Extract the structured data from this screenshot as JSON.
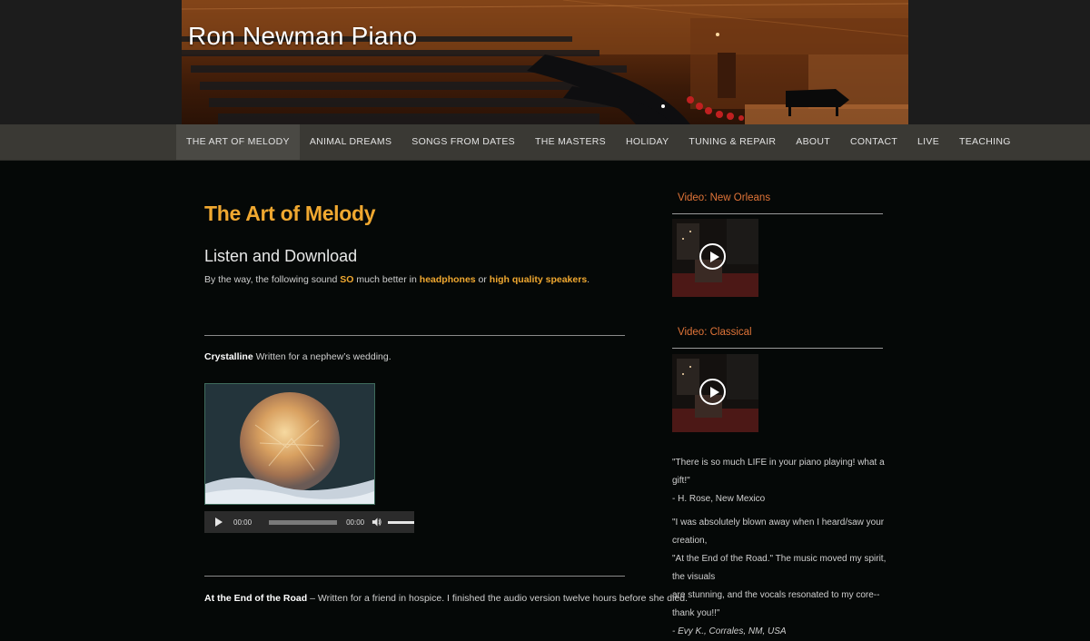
{
  "site": {
    "title": "Ron Newman Piano"
  },
  "nav": {
    "items": [
      {
        "label": "THE ART OF MELODY",
        "active": true
      },
      {
        "label": "ANIMAL DREAMS"
      },
      {
        "label": "SONGS FROM DATES"
      },
      {
        "label": "THE MASTERS"
      },
      {
        "label": "HOLIDAY"
      },
      {
        "label": "TUNING & REPAIR"
      },
      {
        "label": "ABOUT"
      },
      {
        "label": "CONTACT"
      },
      {
        "label": "LIVE"
      },
      {
        "label": "TEACHING"
      }
    ]
  },
  "main": {
    "title": "The Art of Melody",
    "subtitle": "Listen and Download",
    "intro": {
      "part1": "By the way, the following sound ",
      "so": "SO",
      "part2": " much better in ",
      "headphones": "headphones",
      "part3": " or ",
      "speakers": "high quality speakers",
      "part4": "."
    },
    "track1": {
      "name": "Crystalline",
      "desc": " Written for a nephew’s wedding."
    },
    "player": {
      "time_current": "00:00",
      "time_total": "00:00"
    },
    "track2": {
      "name": "At the End of the Road",
      "desc": " – Written for a friend in hospice. I finished the audio version twelve hours before she died."
    }
  },
  "sidebar": {
    "video1": {
      "title": "Video: New Orleans"
    },
    "video2": {
      "title": "Video: Classical"
    },
    "quote1": {
      "text": "\"There is so much LIFE in your piano playing! what a gift!\"",
      "author": "- H. Rose, New Mexico"
    },
    "quote2": {
      "line1": "\"I was absolutely blown away when I heard/saw your creation,",
      "line2": "\"At the End of the Road.\" The music moved my spirit, the visuals",
      "line3": "are stunning, and the vocals resonated to my core--thank you!!\"",
      "author": "- Evy K., Corrales, NM, USA"
    }
  },
  "colors": {
    "accent": "#f0a830",
    "widget_title": "#e07438",
    "nav_bg": "#3a3934",
    "page_bg": "#050807"
  }
}
